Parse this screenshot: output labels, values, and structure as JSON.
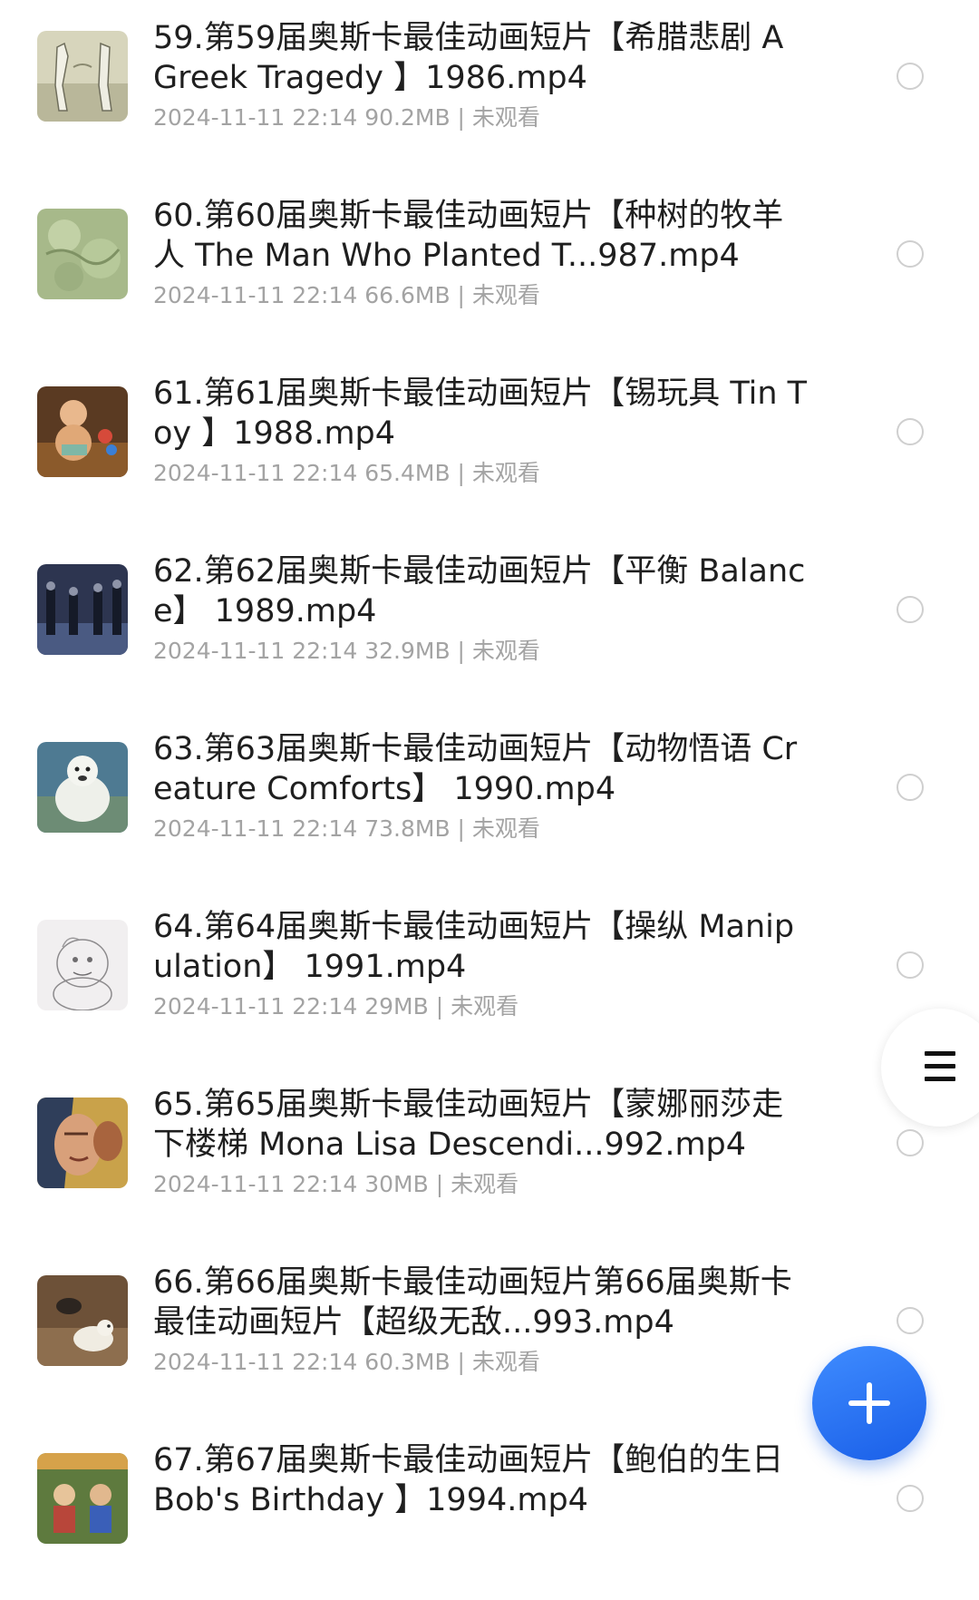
{
  "files": [
    {
      "title": "59.第59届奥斯卡最佳动画短片【希腊悲剧 A Greek Tragedy 】1986.mp4",
      "meta": "2024-11-11 22:14  90.2MB | 未观看",
      "thumbnail_icon": "video-thumbnail"
    },
    {
      "title": "60.第60届奥斯卡最佳动画短片【种树的牧羊人 The Man Who Planted T...987.mp4",
      "meta": "2024-11-11 22:14  66.6MB | 未观看",
      "thumbnail_icon": "video-thumbnail"
    },
    {
      "title": "61.第61届奥斯卡最佳动画短片【锡玩具 Tin Toy 】1988.mp4",
      "meta": "2024-11-11 22:14  65.4MB | 未观看",
      "thumbnail_icon": "video-thumbnail"
    },
    {
      "title": "62.第62届奥斯卡最佳动画短片【平衡 Balance】 1989.mp4",
      "meta": "2024-11-11 22:14  32.9MB | 未观看",
      "thumbnail_icon": "video-thumbnail"
    },
    {
      "title": "63.第63届奥斯卡最佳动画短片【动物悟语 Creature Comforts】 1990.mp4",
      "meta": "2024-11-11 22:14  73.8MB | 未观看",
      "thumbnail_icon": "video-thumbnail"
    },
    {
      "title": "64.第64届奥斯卡最佳动画短片【操纵 Manipulation】 1991.mp4",
      "meta": "2024-11-11 22:14  29MB | 未观看",
      "thumbnail_icon": "video-thumbnail"
    },
    {
      "title": "65.第65届奥斯卡最佳动画短片【蒙娜丽莎走下楼梯 Mona Lisa Descendi...992.mp4",
      "meta": "2024-11-11 22:14  30MB | 未观看",
      "thumbnail_icon": "video-thumbnail"
    },
    {
      "title": "66.第66届奥斯卡最佳动画短片第66届奥斯卡最佳动画短片【超级无敌...993.mp4",
      "meta": "2024-11-11 22:14  60.3MB | 未观看",
      "thumbnail_icon": "video-thumbnail"
    },
    {
      "title": "67.第67届奥斯卡最佳动画短片【鲍伯的生日 Bob's Birthday 】1994.mp4",
      "meta": "",
      "thumbnail_icon": "video-thumbnail"
    }
  ],
  "controls": {
    "menu_icon": "hamburger-menu-icon",
    "fab_icon": "plus-icon",
    "accent_color": "#2a74f5",
    "radio_color": "#cfcfcf"
  }
}
